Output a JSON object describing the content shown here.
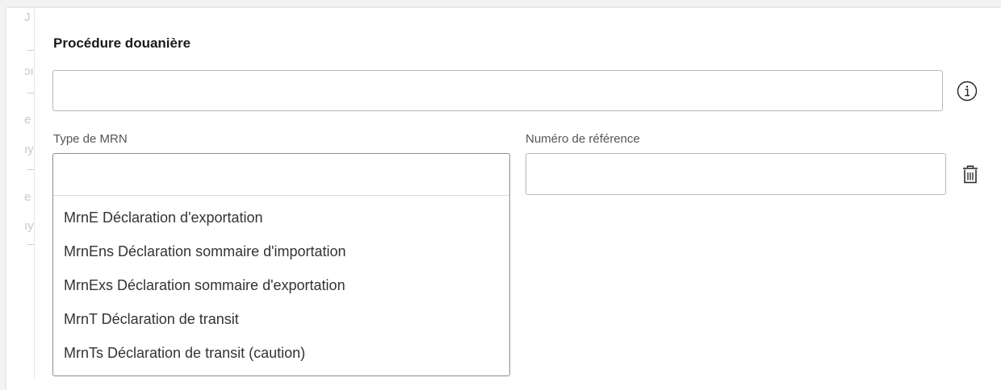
{
  "section": {
    "title": "Procédure douanière"
  },
  "procedure": {
    "value": "",
    "info_icon": "info-circle-icon"
  },
  "mrn_type": {
    "label": "Type de MRN",
    "value": "",
    "options": [
      "MrnE Déclaration d'exportation",
      "MrnEns Déclaration sommaire d'importation",
      "MrnExs Déclaration sommaire d'exportation",
      "MrnT Déclaration de transit",
      "MrnTs Déclaration de transit (caution)"
    ]
  },
  "reference": {
    "label": "Numéro de référence",
    "value": "",
    "delete_icon": "trash-icon"
  },
  "background_fragments": [
    "J",
    "ɔı",
    "e",
    "ıy",
    "e",
    "ıy"
  ],
  "colors": {
    "border": "#b9b9b9",
    "dropdown_border": "#8d8d8d",
    "label": "#555555",
    "title": "#1a1a1a"
  }
}
